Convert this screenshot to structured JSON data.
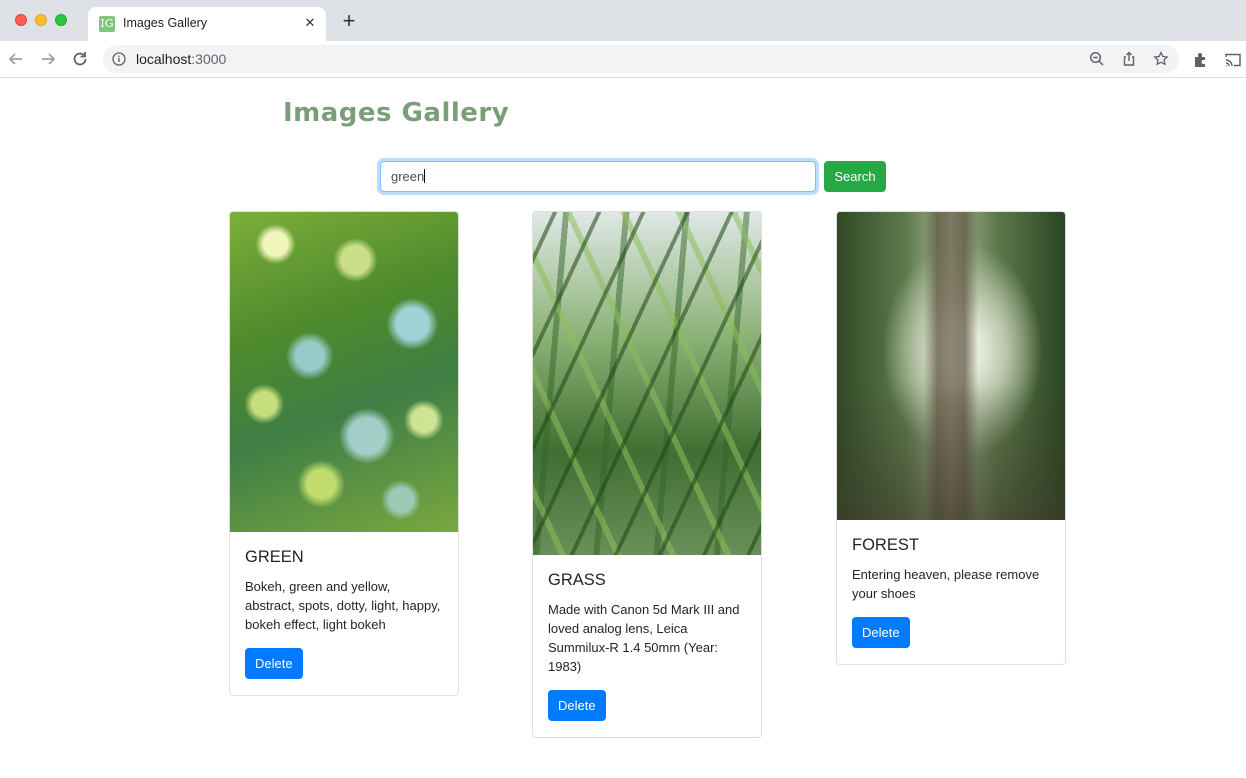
{
  "browser": {
    "tab_title": "Images Gallery",
    "favicon_text": "IG",
    "url_host": "localhost",
    "url_port": ":3000"
  },
  "page": {
    "title": "Images Gallery",
    "search": {
      "value": "green",
      "button_label": "Search"
    }
  },
  "cards": [
    {
      "title": "GREEN",
      "description": "Bokeh, green and yellow, abstract, spots, dotty, light, happy, bokeh effect, light bokeh",
      "button_label": "Delete"
    },
    {
      "title": "GRASS",
      "description": "Made with Canon 5d Mark III and loved analog lens, Leica Summilux-R 1.4 50mm (Year: 1983)",
      "button_label": "Delete"
    },
    {
      "title": "FOREST",
      "description": "Entering heaven, please remove your shoes",
      "button_label": "Delete"
    }
  ],
  "colors": {
    "search_button": "#28a745",
    "delete_button": "#007bff",
    "title": "#7a9e78"
  }
}
